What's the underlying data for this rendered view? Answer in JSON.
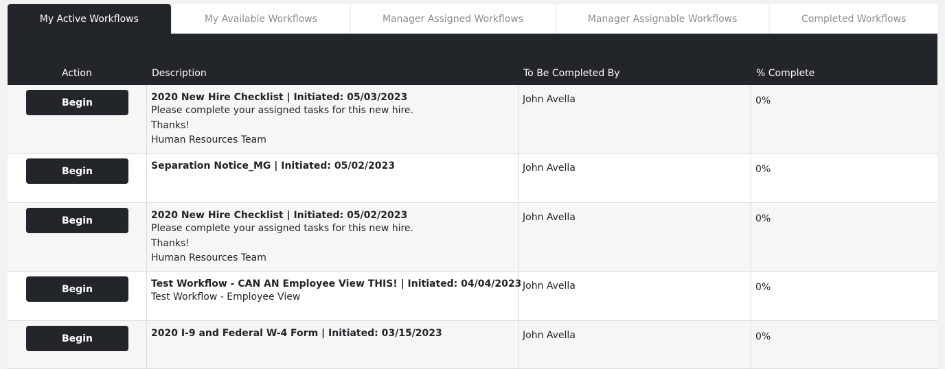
{
  "tabs": [
    {
      "label": "My Active Workflows"
    },
    {
      "label": "My Available Workflows"
    },
    {
      "label": "Manager Assigned Workflows"
    },
    {
      "label": "Manager Assignable Workflows"
    },
    {
      "label": "Completed Workflows"
    }
  ],
  "table": {
    "headers": {
      "action": "Action",
      "description": "Description",
      "completed_by": "To Be Completed By",
      "percent": "% Complete"
    },
    "rows": [
      {
        "action": "Begin",
        "title": "2020 New Hire Checklist | Initiated: 05/03/2023",
        "lines": [
          "Please complete your assigned tasks for this new hire.",
          "Thanks!",
          "Human Resources Team"
        ],
        "completed_by": "John Avella",
        "percent": "0%"
      },
      {
        "action": "Begin",
        "title": "Separation Notice_MG | Initiated: 05/02/2023",
        "lines": [],
        "completed_by": "John Avella",
        "percent": "0%"
      },
      {
        "action": "Begin",
        "title": "2020 New Hire Checklist | Initiated: 05/02/2023",
        "lines": [
          "Please complete your assigned tasks for this new hire.",
          "Thanks!",
          "Human Resources Team"
        ],
        "completed_by": "John Avella",
        "percent": "0%"
      },
      {
        "action": "Begin",
        "title": "Test Workflow - CAN AN Employee View THIS! | Initiated: 04/04/2023",
        "lines": [
          "Test Workflow - Employee View"
        ],
        "completed_by": "John Avella",
        "percent": "0%"
      },
      {
        "action": "Begin",
        "title": "2020 I-9 and Federal W-4 Form | Initiated: 03/15/2023",
        "lines": [],
        "completed_by": "John Avella",
        "percent": "0%"
      }
    ]
  },
  "colors": {
    "dark": "#22252a",
    "tab_inactive_text": "#8a8d91",
    "row_shade": "#f6f6f6"
  }
}
